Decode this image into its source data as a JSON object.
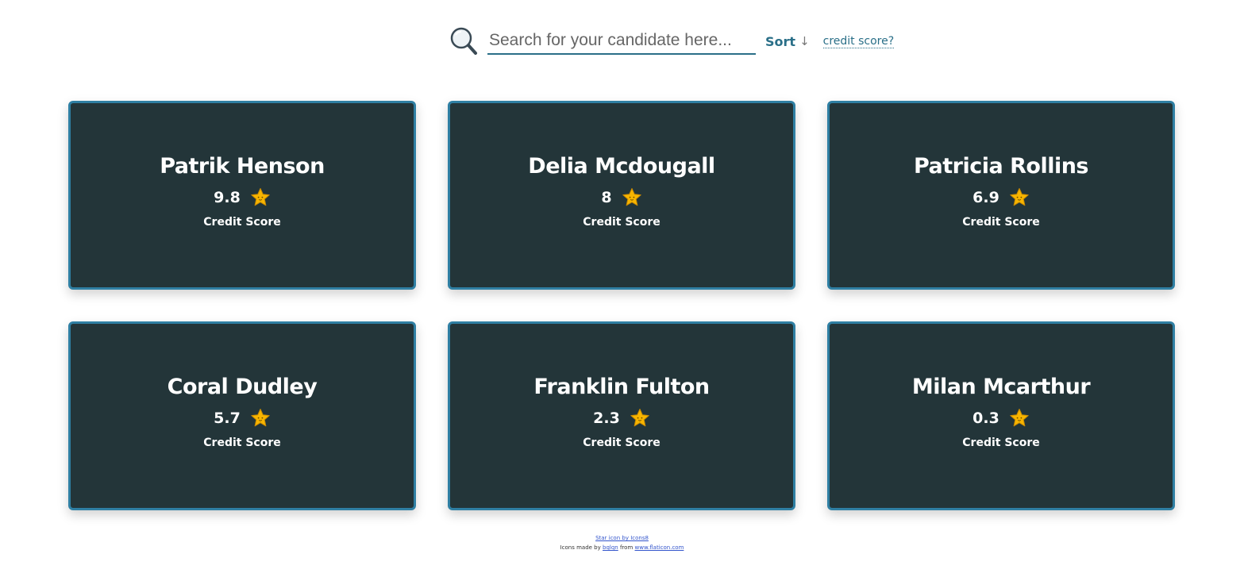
{
  "search": {
    "placeholder": "Search for your candidate here...",
    "value": ""
  },
  "sort": {
    "label": "Sort",
    "arrow": "↓"
  },
  "help_link": "credit score?",
  "colors": {
    "card_background": "#233539",
    "card_border": "#2f7fa3",
    "accent": "#2a6f88",
    "star": "#f7b500"
  },
  "candidates": [
    {
      "name": "Patrik Henson",
      "score": "9.8",
      "label": "Credit Score",
      "icon": "star-icon"
    },
    {
      "name": "Delia Mcdougall",
      "score": "8",
      "label": "Credit Score",
      "icon": "star-icon"
    },
    {
      "name": "Patricia Rollins",
      "score": "6.9",
      "label": "Credit Score",
      "icon": "star-icon"
    },
    {
      "name": "Coral Dudley",
      "score": "5.7",
      "label": "Credit Score",
      "icon": "star-icon"
    },
    {
      "name": "Franklin Fulton",
      "score": "2.3",
      "label": "Credit Score",
      "icon": "star-icon"
    },
    {
      "name": "Milan Mcarthur",
      "score": "0.3",
      "label": "Credit Score",
      "icon": "star-icon"
    }
  ],
  "footer": {
    "line1_link": "Star icon by Icons8",
    "line2_prefix": "Icons made by",
    "line2_author": "bqlqn",
    "line2_mid": "from",
    "line2_site": "www.flaticon.com"
  }
}
